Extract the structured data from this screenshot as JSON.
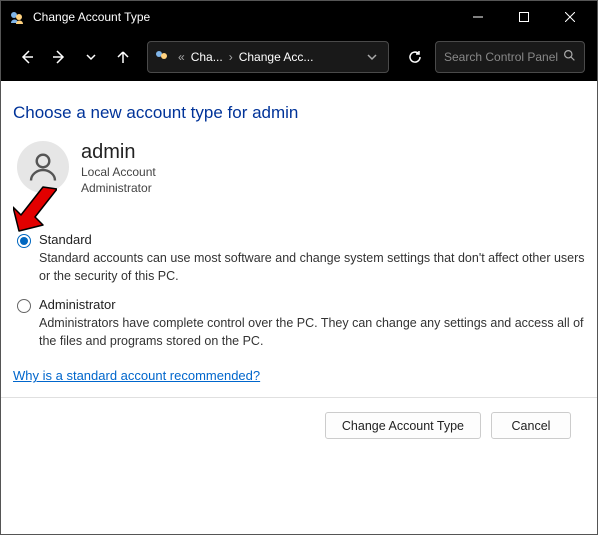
{
  "window": {
    "title": "Change Account Type"
  },
  "nav": {
    "breadcrumbs": {
      "prefix": "«",
      "c1": "Cha...",
      "c2": "Change Acc..."
    },
    "search_placeholder": "Search Control Panel"
  },
  "page": {
    "heading": "Choose a new account type for admin",
    "account": {
      "name": "admin",
      "line1": "Local Account",
      "line2": "Administrator"
    },
    "options": {
      "standard": {
        "label": "Standard",
        "desc": "Standard accounts can use most software and change system settings that don't affect other users or the security of this PC.",
        "selected": true
      },
      "admin": {
        "label": "Administrator",
        "desc": "Administrators have complete control over the PC. They can change any settings and access all of the files and programs stored on the PC.",
        "selected": false
      }
    },
    "help_link": "Why is a standard account recommended?",
    "buttons": {
      "change": "Change Account Type",
      "cancel": "Cancel"
    }
  }
}
